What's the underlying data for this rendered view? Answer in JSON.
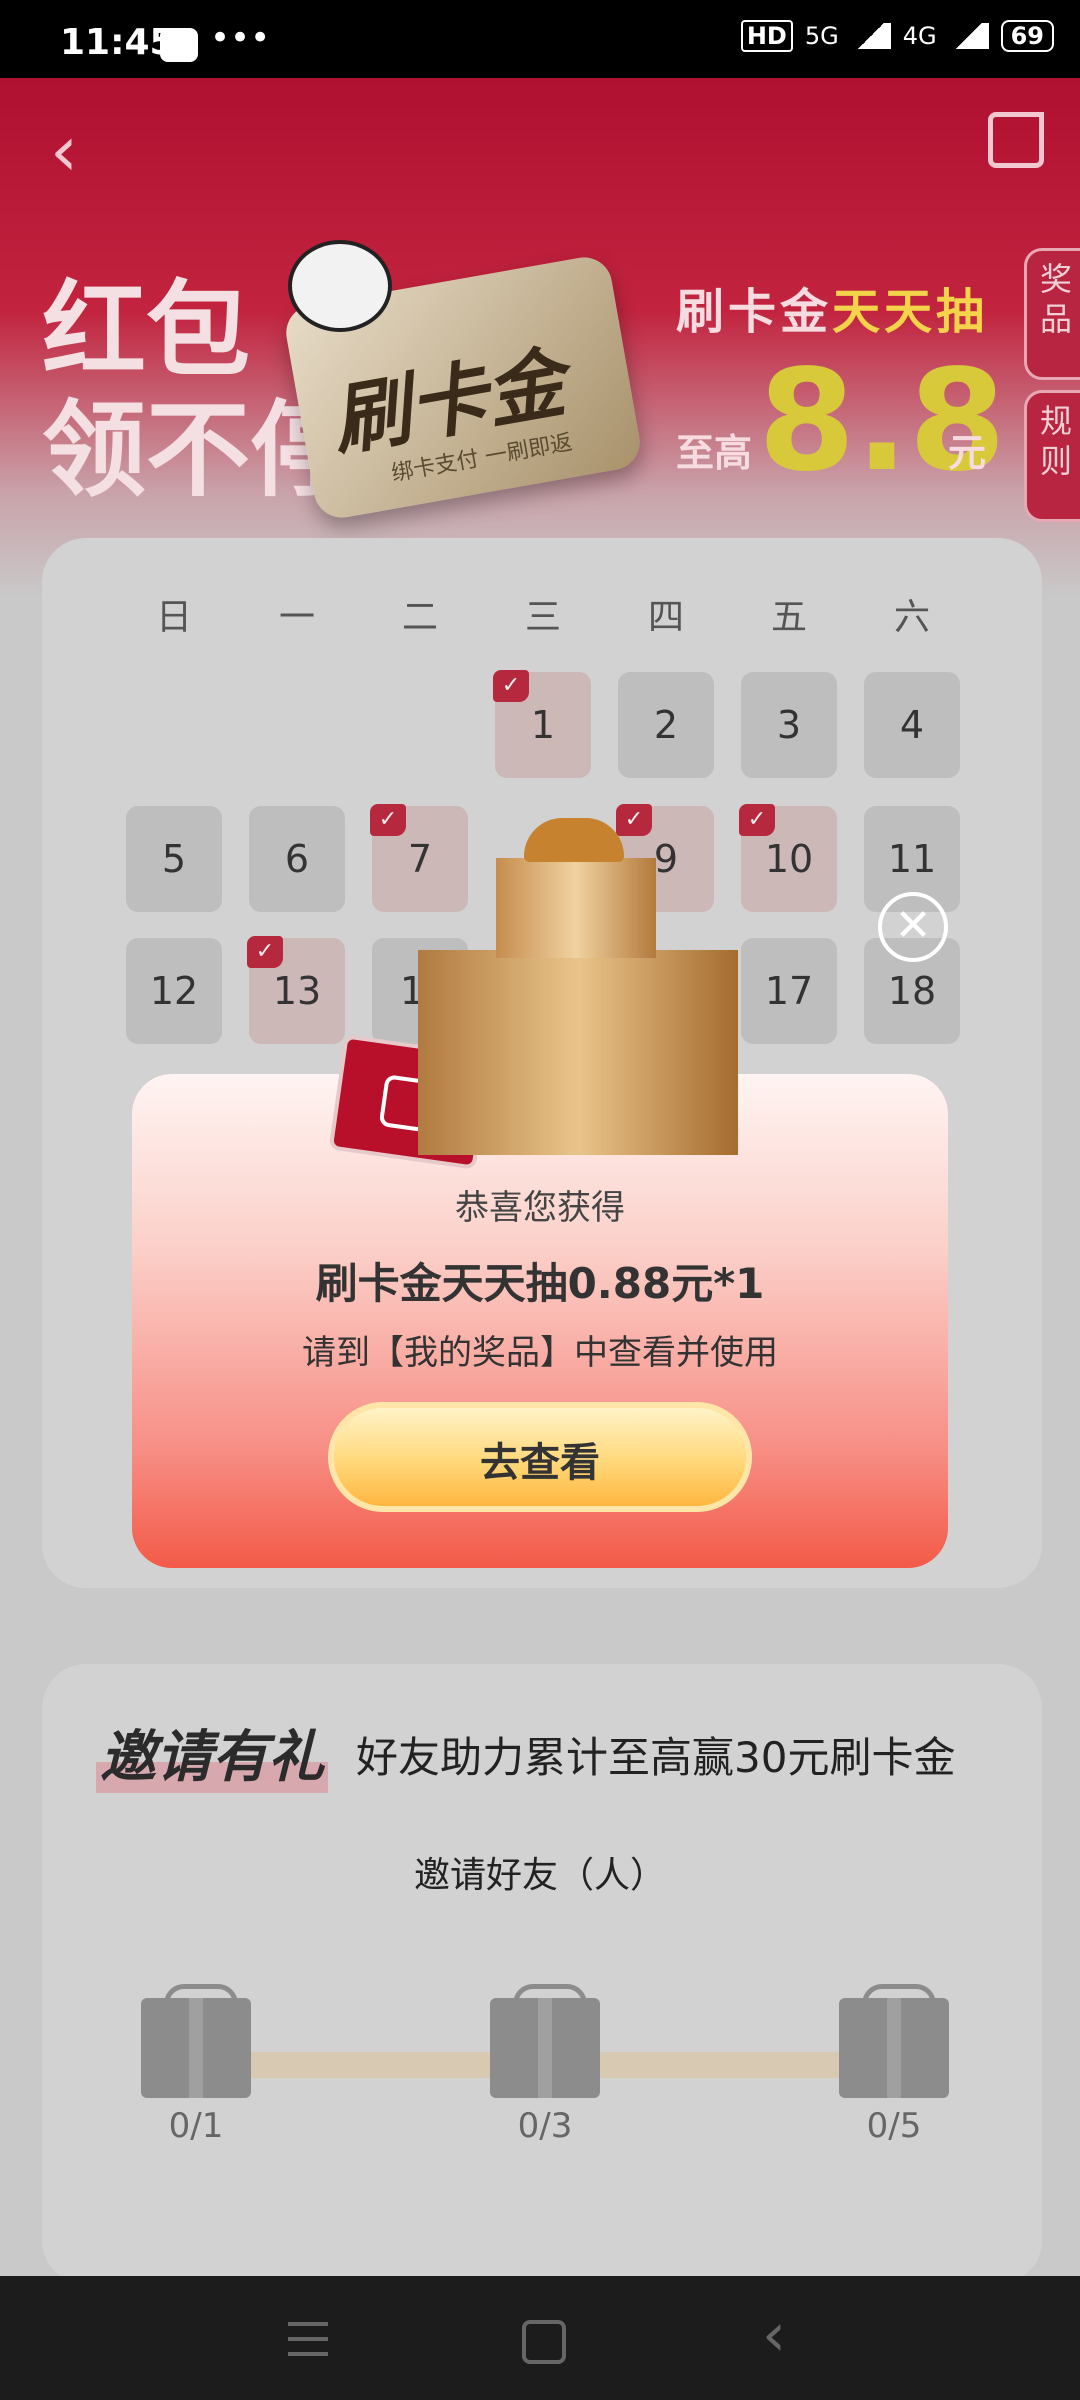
{
  "status_bar": {
    "time": "11:45",
    "dots": "•••",
    "hd": "HD",
    "net5g": "5G",
    "net4g": "4G",
    "battery": "69"
  },
  "header": {
    "back_glyph": "‹"
  },
  "hero": {
    "left_line1": "红包",
    "left_line2": "领不停",
    "card_title": "刷卡金",
    "card_sub": "绑卡支付 一刷即返",
    "promo_prefix": "刷卡金",
    "promo_highlight": "天天抽",
    "promo_upto": "至高",
    "promo_amount": "8.8",
    "promo_unit": "元"
  },
  "side_tabs": {
    "prizes": "奖品",
    "rules": "规则"
  },
  "calendar": {
    "weekdays": [
      "日",
      "一",
      "二",
      "三",
      "四",
      "五",
      "六"
    ],
    "days": [
      {
        "label": "1",
        "checked": true
      },
      {
        "label": "2",
        "checked": false
      },
      {
        "label": "3",
        "checked": false
      },
      {
        "label": "4",
        "checked": false
      },
      {
        "label": "5",
        "checked": false
      },
      {
        "label": "6",
        "checked": false
      },
      {
        "label": "7",
        "checked": true
      },
      {
        "label": "9",
        "checked": true
      },
      {
        "label": "10",
        "checked": true
      },
      {
        "label": "11",
        "checked": false
      },
      {
        "label": "12",
        "checked": false
      },
      {
        "label": "13",
        "checked": true
      },
      {
        "label": "1",
        "checked": false
      },
      {
        "label": "17",
        "checked": false
      },
      {
        "label": "18",
        "checked": false
      }
    ]
  },
  "popup": {
    "close_glyph": "✕",
    "congrats": "恭喜您获得",
    "prize": "刷卡金天天抽0.88元*1",
    "hint": "请到【我的奖品】中查看并使用",
    "cta": "去查看"
  },
  "invite": {
    "title": "邀请有礼",
    "desc": "好友助力累计至高赢30元刷卡金",
    "label": "邀请好友（人）",
    "milestones": [
      "0/1",
      "0/3",
      "0/5"
    ]
  },
  "colors": {
    "brand_red": "#b01030",
    "gold": "#d8c93a",
    "cta_gold": "#ffd87a"
  }
}
